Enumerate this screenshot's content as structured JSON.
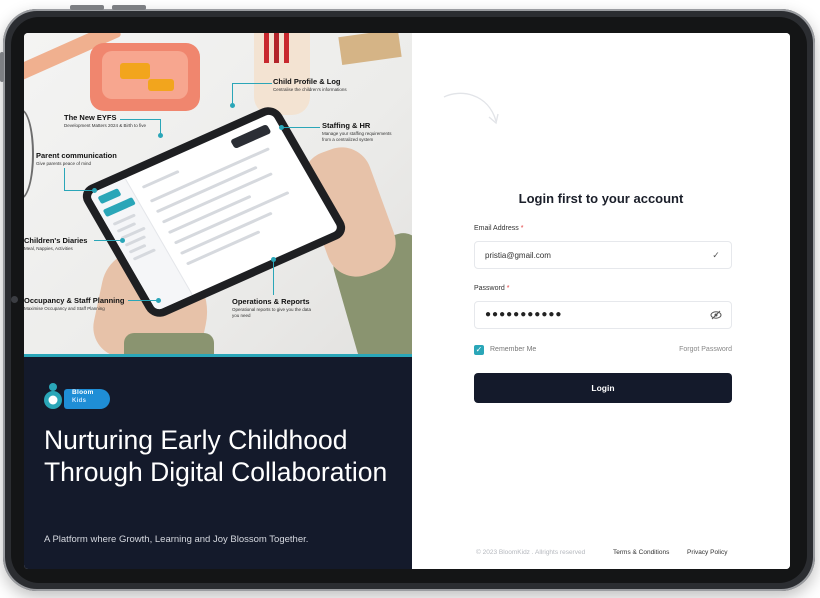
{
  "callouts": {
    "child_profile": {
      "title": "Child Profile & Log",
      "sub": "Centralise the children's informations"
    },
    "eyfs": {
      "title": "The New EYFS",
      "sub": "Development Matters 2024 & Birth to five"
    },
    "staffing": {
      "title": "Staffing & HR",
      "sub1": "Manage your staffing requirements",
      "sub2": "from a centralized system"
    },
    "parent": {
      "title": "Parent communication",
      "sub": "Give parents peace of mind"
    },
    "diaries": {
      "title": "Children's Diaries",
      "sub": "Meal, Nappies, Activities"
    },
    "occupancy": {
      "title": "Occupancy & Staff Planning",
      "sub": "Maximise Occupancy and Staff Planning"
    },
    "operations": {
      "title": "Operations & Reports",
      "sub1": "Operational reports to give you the data",
      "sub2": "you need"
    }
  },
  "brand": {
    "line1": "Bloom",
    "line2": "Kids"
  },
  "hero": {
    "headline": "Nurturing Early Childhood Through Digital Collaboration",
    "tagline": "A Platform where Growth, Learning and Joy Blossom Together."
  },
  "login": {
    "title": "Login first to your account",
    "email_label": "Email Address",
    "email_value": "pristia@gmail.com",
    "password_label": "Password",
    "password_value": "●●●●●●●●●●●",
    "required_mark": "*",
    "remember_label": "Remember Me",
    "forgot_label": "Forgot Password",
    "login_button": "Login"
  },
  "footer": {
    "copyright": "© 2023 BloomKidz . Allrights reserved",
    "terms": "Terms & Conditions",
    "privacy": "Privacy Policy"
  },
  "colors": {
    "accent": "#2aa6b8",
    "dark": "#141a2b",
    "brand_blue": "#1f8ed6"
  },
  "icons": {
    "email_status": "check-icon",
    "password_toggle": "eye-off-icon",
    "checkbox": "check-icon"
  }
}
